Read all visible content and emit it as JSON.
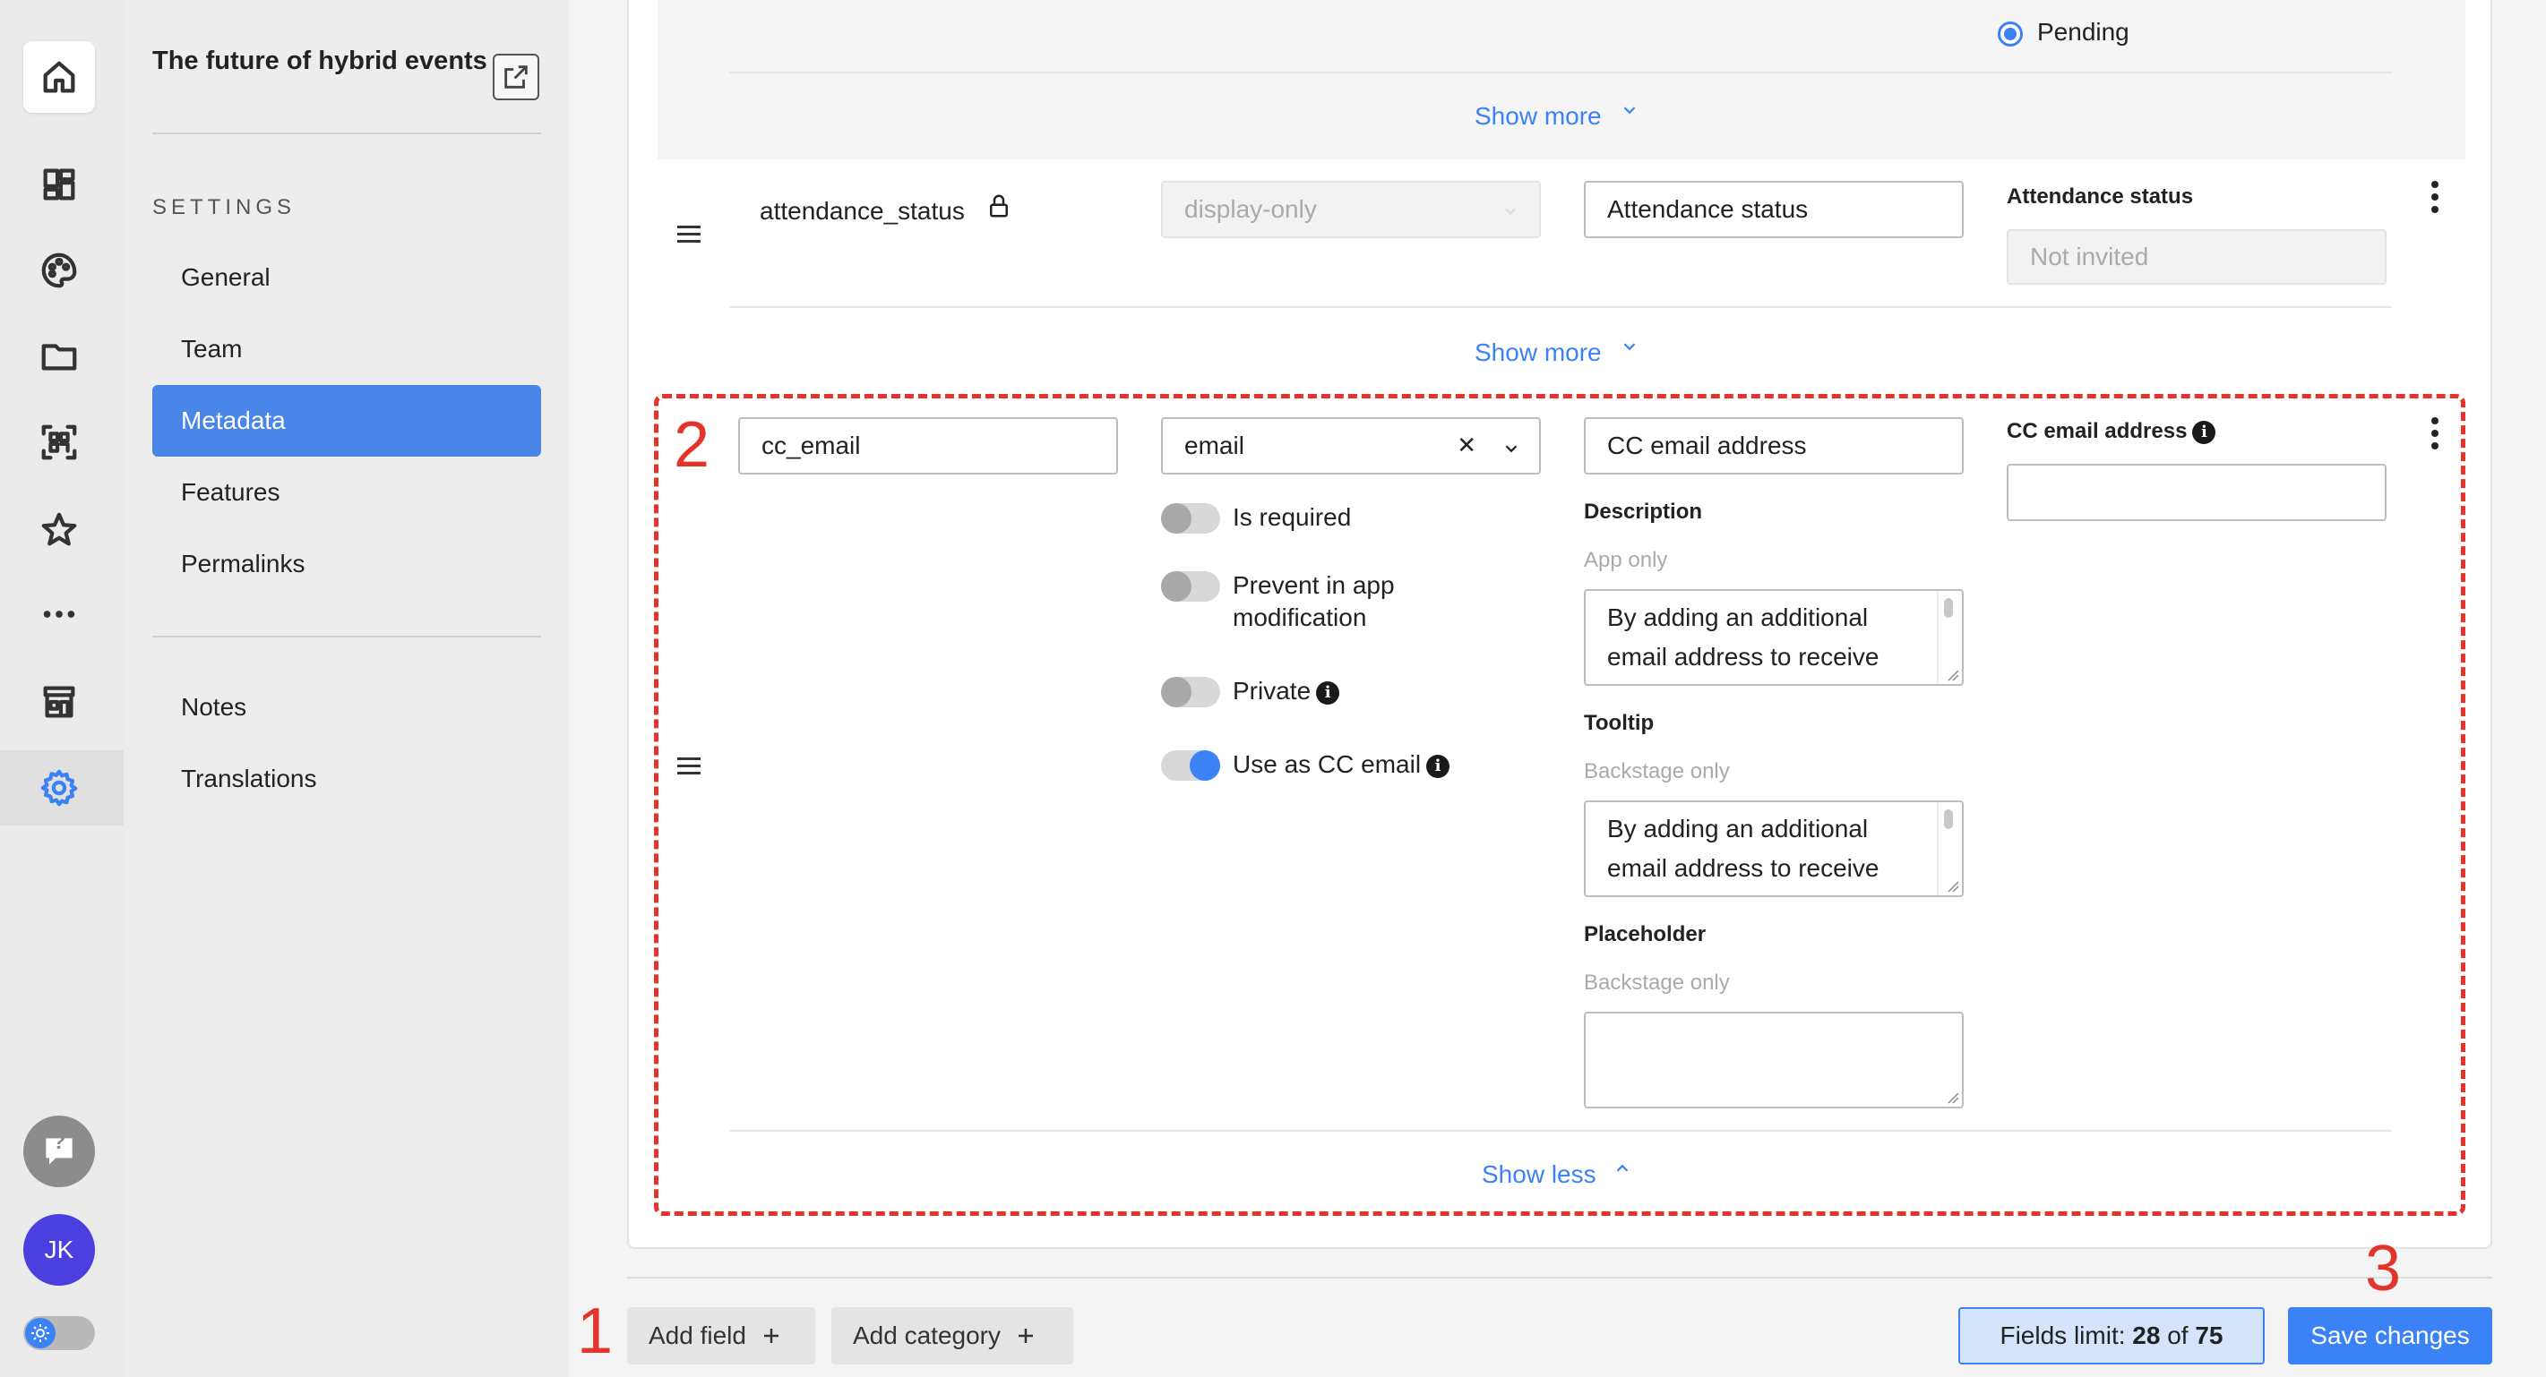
{
  "rail": {
    "items": [
      {
        "name": "home-icon"
      },
      {
        "name": "dashboard-icon"
      },
      {
        "name": "palette-icon"
      },
      {
        "name": "folder-icon"
      },
      {
        "name": "qr-code-icon"
      },
      {
        "name": "star-icon"
      },
      {
        "name": "more-icon"
      },
      {
        "name": "store-icon"
      },
      {
        "name": "gear-icon",
        "active": true
      }
    ],
    "help_glyph": "?",
    "avatar_initials": "JK"
  },
  "sidebar": {
    "event_title": "The future of hybrid events",
    "section_label": "SETTINGS",
    "items": [
      "General",
      "Team",
      "Metadata",
      "Features",
      "Permalinks"
    ],
    "active_item": "Metadata",
    "extra_items": [
      "Notes",
      "Translations"
    ]
  },
  "fields": {
    "top_partial": {
      "radio_label": "Pending",
      "show_more": "Show more"
    },
    "attendance": {
      "key": "attendance_status",
      "type": "display-only",
      "label": "Attendance status",
      "preview_title": "Attendance status",
      "preview_placeholder": "Not invited",
      "show_more": "Show more"
    },
    "cc_email": {
      "key": "cc_email",
      "type": "email",
      "clear_glyph": "✕",
      "label": "CC email address",
      "toggles": [
        {
          "label_line1": "Is required",
          "label_line2": "",
          "on": false,
          "info": false
        },
        {
          "label_line1": "Prevent in app",
          "label_line2": "modification",
          "on": false,
          "info": false
        },
        {
          "label_line1": "Private",
          "label_line2": "",
          "on": false,
          "info": true
        },
        {
          "label_line1": "Use as CC email",
          "label_line2": "",
          "on": true,
          "info": true
        }
      ],
      "description": {
        "title": "Description",
        "sub": "App only",
        "line1": "By adding an additional",
        "line2": "email address to receive"
      },
      "tooltip": {
        "title": "Tooltip",
        "sub": "Backstage only",
        "line1": "By adding an additional",
        "line2": "email address to receive"
      },
      "placeholder": {
        "title": "Placeholder",
        "sub": "Backstage only"
      },
      "preview_title": "CC email address",
      "show_less": "Show less"
    }
  },
  "footer": {
    "add_field": "Add field",
    "add_category": "Add category",
    "limit_prefix": "Fields limit:",
    "limit_used": "28",
    "limit_of": "of",
    "limit_total": "75",
    "save": "Save changes"
  },
  "annotations": [
    "1",
    "2",
    "3"
  ],
  "colors": {
    "accent": "#3b82f6",
    "annotation": "#e4332a",
    "active_nav": "#4a86e8"
  }
}
